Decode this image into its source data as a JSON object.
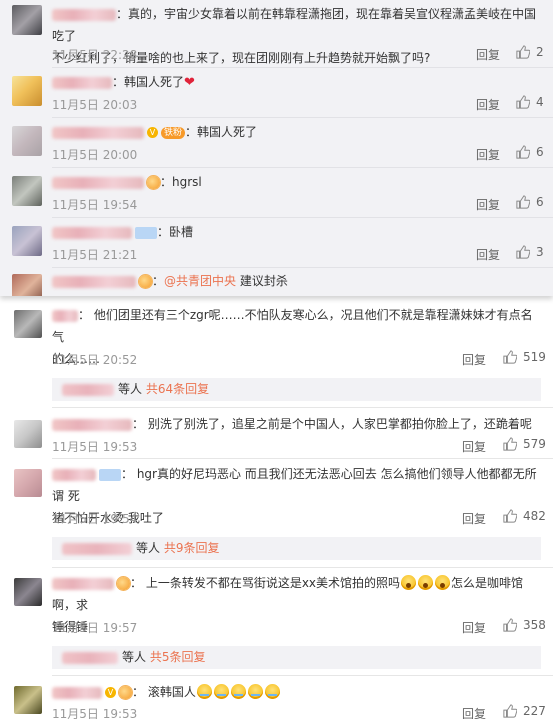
{
  "top_comments": [
    {
      "text_html": "真的，宇宙少女靠着以前在韩靠程潇拖团，现在靠着吴宣仪程潇孟美岐在中国吃了",
      "text_line2": "不少红利了，销量啥的也上来了，现在团刚刚有上升趋势就开始飘了吗?",
      "time": "11月5日 22:28",
      "reply": "回复",
      "likes": "2"
    },
    {
      "text": "韩国人死了",
      "time": "11月5日 20:03",
      "reply": "回复",
      "likes": "4"
    },
    {
      "fan_badge": "铁粉",
      "text": "韩国人死了",
      "time": "11月5日 20:00",
      "reply": "回复",
      "likes": "6"
    },
    {
      "text": "hgrsl",
      "time": "11月5日 19:54",
      "reply": "回复",
      "likes": "6"
    },
    {
      "text": "卧槽",
      "time": "11月5日 21:21",
      "reply": "回复",
      "likes": "3"
    },
    {
      "mention": "@共青团中央",
      "text": "建议封杀"
    }
  ],
  "comments": [
    {
      "text_line1": "他们团里还有三个zgr呢……不怕队友寒心么，况且他们不就是靠程潇妹妹才有点名气",
      "text_line2": "的么……",
      "time": "11月5日 20:52",
      "reply": "回复",
      "likes": "519",
      "sub_suffix": "等人",
      "sub_more": "共64条回复"
    },
    {
      "text": "别洗了别洗了，追星之前是个中国人，人家巴掌都拍你脸上了，还跪着呢",
      "time": "11月5日 19:53",
      "reply": "回复",
      "likes": "579"
    },
    {
      "text_line1": "hgr真的好尼玛恶心 而且我们还无法恶心回去 怎么搞他们领导人他都都无所谓 死",
      "text_line2": "猪不怕开水烫 我吐了",
      "time": "11月5日 19:54",
      "reply": "回复",
      "likes": "482",
      "sub_suffix": "等人",
      "sub_more": "共9条回复"
    },
    {
      "text_line1a": "上一条转发不都在骂街说这是xx美术馆拍的照吗",
      "text_line1b": "怎么是咖啡馆啊，求",
      "text_line2": "锤得锤",
      "time": "11月5日 19:57",
      "reply": "回复",
      "likes": "358",
      "sub_suffix": "等人",
      "sub_more": "共5条回复"
    },
    {
      "text": "滚韩国人",
      "time": "11月5日 19:53",
      "reply": "回复",
      "likes": "227"
    }
  ],
  "colors": {
    "accent": "#eb7350",
    "meta": "#999999",
    "panel": "#f2f2f5"
  },
  "icons": {
    "like": "thumbs-up-icon",
    "heart": "heart-icon",
    "verified": "v-badge-icon"
  }
}
